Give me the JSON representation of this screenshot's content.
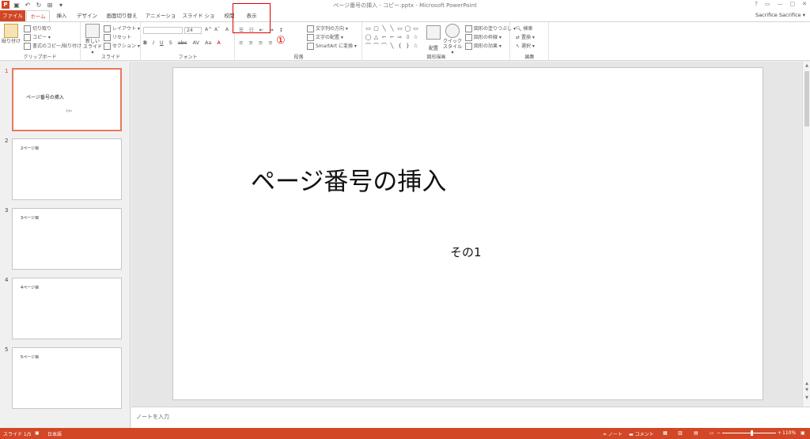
{
  "titlebar": {
    "title": "ページ番号の挿入 - コピー.pptx - Microsoft PowerPoint",
    "logo": "P",
    "qat_icons": [
      "save-icon",
      "undo-icon",
      "redo-icon",
      "start-from-beginning-icon",
      "qat-dropdown-icon"
    ],
    "window_controls": [
      "?",
      "▭",
      "—",
      "▢",
      "✕"
    ]
  },
  "tabs": [
    {
      "label": "ファイル"
    },
    {
      "label": "ホーム"
    },
    {
      "label": "挿入"
    },
    {
      "label": "デザイン"
    },
    {
      "label": "画面切り替え"
    },
    {
      "label": "アニメーション"
    },
    {
      "label": "スライド ショー"
    },
    {
      "label": "校閲"
    },
    {
      "label": "表示"
    }
  ],
  "user": "Sacrifice Sacrifice ▾",
  "annotation": "①",
  "ribbon": {
    "clipboard": {
      "paste": "貼り付け",
      "cut": "切り取り",
      "copy": "コピー ▾",
      "format_painter": "書式のコピー/貼り付け",
      "label": "クリップボード"
    },
    "slides": {
      "new_slide": "新しい",
      "new_slide2": "スライド ▾",
      "layout": "レイアウト ▾",
      "reset": "リセット",
      "section": "セクション ▾",
      "label": "スライド"
    },
    "font": {
      "size": "24",
      "bold": "B",
      "italic": "I",
      "underline": "U",
      "shadow": "S",
      "strike": "abc",
      "spacing": "AV",
      "case": "Aa",
      "grow": "A^",
      "shrink": "Aˇ",
      "clear": "A",
      "label": "フォント"
    },
    "paragraph": {
      "text_direction": "文字列の方向 ▾",
      "align_text": "文字の配置 ▾",
      "smartart": "SmartArt に変換 ▾",
      "label": "段落"
    },
    "drawing": {
      "arrange": "配置",
      "quick_styles": "クイック",
      "quick_styles2": "スタイル ▾",
      "fill": "図形の塗りつぶし ▾",
      "outline": "図形の枠線 ▾",
      "effects": "図形の効果 ▾",
      "label": "図形描画",
      "shapes": [
        "▭",
        "▢",
        "╲",
        "╲",
        "▭",
        "◯",
        "▭",
        "◯",
        "△",
        "⌐",
        "⌐",
        "⇨",
        "⇩",
        "☆",
        "⌒",
        "⌒",
        "⌒",
        "╲",
        "{",
        "}",
        "☆"
      ]
    },
    "editing": {
      "find": "検索",
      "replace": "置換 ▾",
      "select": "選択 ▾",
      "label": "編集"
    }
  },
  "slides": [
    {
      "number": "1",
      "title": "ページ番号の挿入",
      "subtitle": "その1",
      "selected": true
    },
    {
      "number": "2",
      "text": "2ページ目"
    },
    {
      "number": "3",
      "text": "3ページ目"
    },
    {
      "number": "4",
      "text": "4ページ目"
    },
    {
      "number": "5",
      "text": "5ページ目"
    }
  ],
  "main_slide": {
    "title": "ページ番号の挿入",
    "subtitle": "その1"
  },
  "notes": {
    "placeholder": "ノートを入力"
  },
  "status": {
    "slide_info": "スライド 1/5",
    "language": "日本語",
    "notes_btn": "≐ ノート",
    "comments_btn": "▬ コメント",
    "zoom": "110%",
    "zoom_level_fraction": 0.55
  },
  "colors": {
    "accent": "#d24726",
    "annotation": "#e00000"
  }
}
